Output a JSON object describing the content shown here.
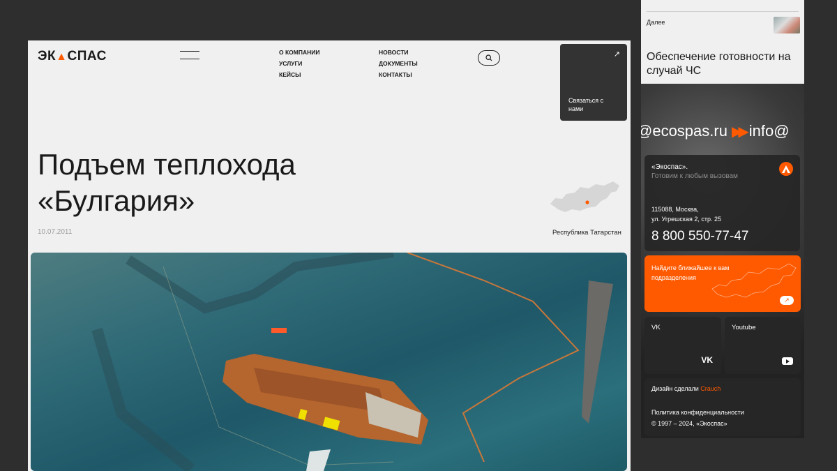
{
  "header": {
    "logo_left": "ЭК",
    "logo_right": "СПАС",
    "menu_col1": [
      "О КОМПАНИИ",
      "УСЛУГИ",
      "КЕЙСЫ"
    ],
    "menu_col2": [
      "НОВОСТИ",
      "ДОКУМЕНТЫ",
      "КОНТАКТЫ"
    ],
    "contact_label": "Связаться с нами"
  },
  "article": {
    "title": "Подъем теплохода «Булгария»",
    "date": "10.07.2011",
    "region": "Республика Татарстан"
  },
  "mobile": {
    "next_label": "Далее",
    "next_title": "Обеспечение готовности на случай ЧС",
    "ticker": "@ecospas.ru",
    "ticker_arrows": "▶▶",
    "ticker_tail": "info@",
    "company_name": "«Экоспас».",
    "slogan": "Готовим к любым вызовам",
    "address_line1": "115088, Москва,",
    "address_line2": "ул. Угрешская 2, стр. 25",
    "phone": "8 800 550-77-47",
    "nearest": "Найдите ближайшее к вам подразделения",
    "vk_label": "VK",
    "vk_icon": "VK",
    "youtube_label": "Youtube",
    "design_prefix": "Дизайн сделали",
    "design_studio": "Crauch",
    "policy": "Политика конфиденциальности",
    "copyright": "© 1997 – 2024, «Экоспас»"
  },
  "colors": {
    "accent": "#ff5a00",
    "bg_dark": "#2e2e2e",
    "page_bg": "#f0f0f0"
  }
}
